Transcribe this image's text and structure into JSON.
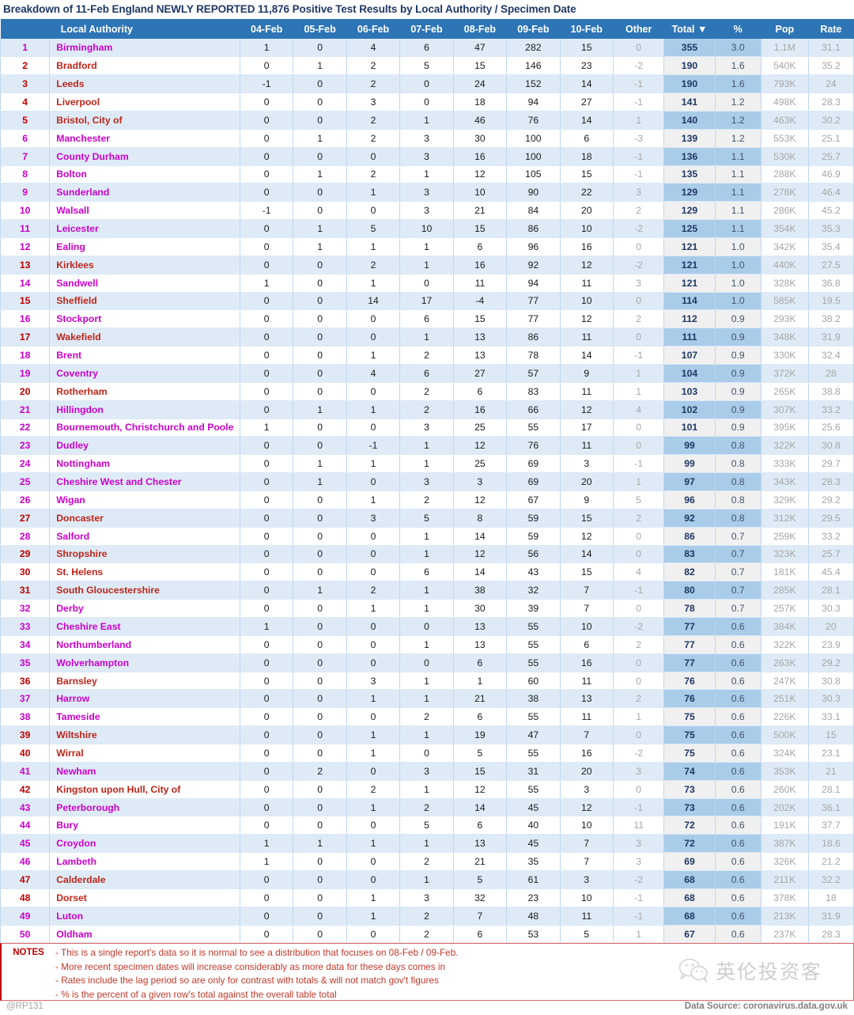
{
  "title": "Breakdown of 11-Feb England NEWLY REPORTED 11,876 Positive Test Results by Local Authority / Specimen Date",
  "colors": {
    "header_bg": "#2E75B6",
    "band_bg": "#DEEBF7",
    "total_band": "#A9CCE9",
    "magenta": "#CC00CC",
    "red": "#C0251A",
    "note_red": "#C0392B",
    "title_navy": "#1F3864"
  },
  "table": {
    "headers": [
      "",
      "Local Authority",
      "04-Feb",
      "05-Feb",
      "06-Feb",
      "07-Feb",
      "08-Feb",
      "09-Feb",
      "10-Feb",
      "Other",
      "Total ▼",
      "%",
      "Pop",
      "Rate"
    ],
    "sort_column": "Total",
    "sort_direction": "descending",
    "rows": [
      {
        "rank": "1",
        "la": "Birmingham",
        "color": "magenta",
        "d": [
          "1",
          "0",
          "4",
          "6",
          "47",
          "282",
          "15"
        ],
        "other": "0",
        "total": "355",
        "pct": "3.0",
        "pop": "1.1M",
        "rate": "31.1"
      },
      {
        "rank": "2",
        "la": "Bradford",
        "color": "red",
        "d": [
          "0",
          "1",
          "2",
          "5",
          "15",
          "146",
          "23"
        ],
        "other": "-2",
        "total": "190",
        "pct": "1.6",
        "pop": "540K",
        "rate": "35.2"
      },
      {
        "rank": "3",
        "la": "Leeds",
        "color": "red",
        "d": [
          "-1",
          "0",
          "2",
          "0",
          "24",
          "152",
          "14"
        ],
        "other": "-1",
        "total": "190",
        "pct": "1.6",
        "pop": "793K",
        "rate": "24"
      },
      {
        "rank": "4",
        "la": "Liverpool",
        "color": "red",
        "d": [
          "0",
          "0",
          "3",
          "0",
          "18",
          "94",
          "27"
        ],
        "other": "-1",
        "total": "141",
        "pct": "1.2",
        "pop": "498K",
        "rate": "28.3"
      },
      {
        "rank": "5",
        "la": "Bristol, City of",
        "color": "red",
        "d": [
          "0",
          "0",
          "2",
          "1",
          "46",
          "76",
          "14"
        ],
        "other": "1",
        "total": "140",
        "pct": "1.2",
        "pop": "463K",
        "rate": "30.2"
      },
      {
        "rank": "6",
        "la": "Manchester",
        "color": "magenta",
        "d": [
          "0",
          "1",
          "2",
          "3",
          "30",
          "100",
          "6"
        ],
        "other": "-3",
        "total": "139",
        "pct": "1.2",
        "pop": "553K",
        "rate": "25.1"
      },
      {
        "rank": "7",
        "la": "County Durham",
        "color": "magenta",
        "d": [
          "0",
          "0",
          "0",
          "3",
          "16",
          "100",
          "18"
        ],
        "other": "-1",
        "total": "136",
        "pct": "1.1",
        "pop": "530K",
        "rate": "25.7"
      },
      {
        "rank": "8",
        "la": "Bolton",
        "color": "magenta",
        "d": [
          "0",
          "1",
          "2",
          "1",
          "12",
          "105",
          "15"
        ],
        "other": "-1",
        "total": "135",
        "pct": "1.1",
        "pop": "288K",
        "rate": "46.9"
      },
      {
        "rank": "9",
        "la": "Sunderland",
        "color": "magenta",
        "d": [
          "0",
          "0",
          "1",
          "3",
          "10",
          "90",
          "22"
        ],
        "other": "3",
        "total": "129",
        "pct": "1.1",
        "pop": "278K",
        "rate": "46.4"
      },
      {
        "rank": "10",
        "la": "Walsall",
        "color": "magenta",
        "d": [
          "-1",
          "0",
          "0",
          "3",
          "21",
          "84",
          "20"
        ],
        "other": "2",
        "total": "129",
        "pct": "1.1",
        "pop": "286K",
        "rate": "45.2"
      },
      {
        "rank": "11",
        "la": "Leicester",
        "color": "magenta",
        "d": [
          "0",
          "1",
          "5",
          "10",
          "15",
          "86",
          "10"
        ],
        "other": "-2",
        "total": "125",
        "pct": "1.1",
        "pop": "354K",
        "rate": "35.3"
      },
      {
        "rank": "12",
        "la": "Ealing",
        "color": "magenta",
        "d": [
          "0",
          "1",
          "1",
          "1",
          "6",
          "96",
          "16"
        ],
        "other": "0",
        "total": "121",
        "pct": "1.0",
        "pop": "342K",
        "rate": "35.4"
      },
      {
        "rank": "13",
        "la": "Kirklees",
        "color": "red",
        "d": [
          "0",
          "0",
          "2",
          "1",
          "16",
          "92",
          "12"
        ],
        "other": "-2",
        "total": "121",
        "pct": "1.0",
        "pop": "440K",
        "rate": "27.5"
      },
      {
        "rank": "14",
        "la": "Sandwell",
        "color": "magenta",
        "d": [
          "1",
          "0",
          "1",
          "0",
          "11",
          "94",
          "11"
        ],
        "other": "3",
        "total": "121",
        "pct": "1.0",
        "pop": "328K",
        "rate": "36.8"
      },
      {
        "rank": "15",
        "la": "Sheffield",
        "color": "red",
        "d": [
          "0",
          "0",
          "14",
          "17",
          "-4",
          "77",
          "10"
        ],
        "other": "0",
        "total": "114",
        "pct": "1.0",
        "pop": "585K",
        "rate": "19.5"
      },
      {
        "rank": "16",
        "la": "Stockport",
        "color": "magenta",
        "d": [
          "0",
          "0",
          "0",
          "6",
          "15",
          "77",
          "12"
        ],
        "other": "2",
        "total": "112",
        "pct": "0.9",
        "pop": "293K",
        "rate": "38.2"
      },
      {
        "rank": "17",
        "la": "Wakefield",
        "color": "red",
        "d": [
          "0",
          "0",
          "0",
          "1",
          "13",
          "86",
          "11"
        ],
        "other": "0",
        "total": "111",
        "pct": "0.9",
        "pop": "348K",
        "rate": "31.9"
      },
      {
        "rank": "18",
        "la": "Brent",
        "color": "magenta",
        "d": [
          "0",
          "0",
          "1",
          "2",
          "13",
          "78",
          "14"
        ],
        "other": "-1",
        "total": "107",
        "pct": "0.9",
        "pop": "330K",
        "rate": "32.4"
      },
      {
        "rank": "19",
        "la": "Coventry",
        "color": "magenta",
        "d": [
          "0",
          "0",
          "4",
          "6",
          "27",
          "57",
          "9"
        ],
        "other": "1",
        "total": "104",
        "pct": "0.9",
        "pop": "372K",
        "rate": "28"
      },
      {
        "rank": "20",
        "la": "Rotherham",
        "color": "red",
        "d": [
          "0",
          "0",
          "0",
          "2",
          "6",
          "83",
          "11"
        ],
        "other": "1",
        "total": "103",
        "pct": "0.9",
        "pop": "265K",
        "rate": "38.8"
      },
      {
        "rank": "21",
        "la": "Hillingdon",
        "color": "magenta",
        "d": [
          "0",
          "1",
          "1",
          "2",
          "16",
          "66",
          "12"
        ],
        "other": "4",
        "total": "102",
        "pct": "0.9",
        "pop": "307K",
        "rate": "33.2"
      },
      {
        "rank": "22",
        "la": "Bournemouth, Christchurch and Poole",
        "color": "magenta",
        "d": [
          "1",
          "0",
          "0",
          "3",
          "25",
          "55",
          "17"
        ],
        "other": "0",
        "total": "101",
        "pct": "0.9",
        "pop": "395K",
        "rate": "25.6"
      },
      {
        "rank": "23",
        "la": "Dudley",
        "color": "magenta",
        "d": [
          "0",
          "0",
          "-1",
          "1",
          "12",
          "76",
          "11"
        ],
        "other": "0",
        "total": "99",
        "pct": "0.8",
        "pop": "322K",
        "rate": "30.8"
      },
      {
        "rank": "24",
        "la": "Nottingham",
        "color": "magenta",
        "d": [
          "0",
          "1",
          "1",
          "1",
          "25",
          "69",
          "3"
        ],
        "other": "-1",
        "total": "99",
        "pct": "0.8",
        "pop": "333K",
        "rate": "29.7"
      },
      {
        "rank": "25",
        "la": "Cheshire West and Chester",
        "color": "magenta",
        "d": [
          "0",
          "1",
          "0",
          "3",
          "3",
          "69",
          "20"
        ],
        "other": "1",
        "total": "97",
        "pct": "0.8",
        "pop": "343K",
        "rate": "28.3"
      },
      {
        "rank": "26",
        "la": "Wigan",
        "color": "magenta",
        "d": [
          "0",
          "0",
          "1",
          "2",
          "12",
          "67",
          "9"
        ],
        "other": "5",
        "total": "96",
        "pct": "0.8",
        "pop": "329K",
        "rate": "29.2"
      },
      {
        "rank": "27",
        "la": "Doncaster",
        "color": "red",
        "d": [
          "0",
          "0",
          "3",
          "5",
          "8",
          "59",
          "15"
        ],
        "other": "2",
        "total": "92",
        "pct": "0.8",
        "pop": "312K",
        "rate": "29.5"
      },
      {
        "rank": "28",
        "la": "Salford",
        "color": "magenta",
        "d": [
          "0",
          "0",
          "0",
          "1",
          "14",
          "59",
          "12"
        ],
        "other": "0",
        "total": "86",
        "pct": "0.7",
        "pop": "259K",
        "rate": "33.2"
      },
      {
        "rank": "29",
        "la": "Shropshire",
        "color": "red",
        "d": [
          "0",
          "0",
          "0",
          "1",
          "12",
          "56",
          "14"
        ],
        "other": "0",
        "total": "83",
        "pct": "0.7",
        "pop": "323K",
        "rate": "25.7"
      },
      {
        "rank": "30",
        "la": "St. Helens",
        "color": "red",
        "d": [
          "0",
          "0",
          "0",
          "6",
          "14",
          "43",
          "15"
        ],
        "other": "4",
        "total": "82",
        "pct": "0.7",
        "pop": "181K",
        "rate": "45.4"
      },
      {
        "rank": "31",
        "la": "South Gloucestershire",
        "color": "red",
        "d": [
          "0",
          "1",
          "2",
          "1",
          "38",
          "32",
          "7"
        ],
        "other": "-1",
        "total": "80",
        "pct": "0.7",
        "pop": "285K",
        "rate": "28.1"
      },
      {
        "rank": "32",
        "la": "Derby",
        "color": "magenta",
        "d": [
          "0",
          "0",
          "1",
          "1",
          "30",
          "39",
          "7"
        ],
        "other": "0",
        "total": "78",
        "pct": "0.7",
        "pop": "257K",
        "rate": "30.3"
      },
      {
        "rank": "33",
        "la": "Cheshire East",
        "color": "magenta",
        "d": [
          "1",
          "0",
          "0",
          "0",
          "13",
          "55",
          "10"
        ],
        "other": "-2",
        "total": "77",
        "pct": "0.6",
        "pop": "384K",
        "rate": "20"
      },
      {
        "rank": "34",
        "la": "Northumberland",
        "color": "magenta",
        "d": [
          "0",
          "0",
          "0",
          "1",
          "13",
          "55",
          "6"
        ],
        "other": "2",
        "total": "77",
        "pct": "0.6",
        "pop": "322K",
        "rate": "23.9"
      },
      {
        "rank": "35",
        "la": "Wolverhampton",
        "color": "magenta",
        "d": [
          "0",
          "0",
          "0",
          "0",
          "6",
          "55",
          "16"
        ],
        "other": "0",
        "total": "77",
        "pct": "0.6",
        "pop": "263K",
        "rate": "29.2"
      },
      {
        "rank": "36",
        "la": "Barnsley",
        "color": "red",
        "d": [
          "0",
          "0",
          "3",
          "1",
          "1",
          "60",
          "11"
        ],
        "other": "0",
        "total": "76",
        "pct": "0.6",
        "pop": "247K",
        "rate": "30.8"
      },
      {
        "rank": "37",
        "la": "Harrow",
        "color": "magenta",
        "d": [
          "0",
          "0",
          "1",
          "1",
          "21",
          "38",
          "13"
        ],
        "other": "2",
        "total": "76",
        "pct": "0.6",
        "pop": "251K",
        "rate": "30.3"
      },
      {
        "rank": "38",
        "la": "Tameside",
        "color": "magenta",
        "d": [
          "0",
          "0",
          "0",
          "2",
          "6",
          "55",
          "11"
        ],
        "other": "1",
        "total": "75",
        "pct": "0.6",
        "pop": "226K",
        "rate": "33.1"
      },
      {
        "rank": "39",
        "la": "Wiltshire",
        "color": "red",
        "d": [
          "0",
          "0",
          "1",
          "1",
          "19",
          "47",
          "7"
        ],
        "other": "0",
        "total": "75",
        "pct": "0.6",
        "pop": "500K",
        "rate": "15"
      },
      {
        "rank": "40",
        "la": "Wirral",
        "color": "red",
        "d": [
          "0",
          "0",
          "1",
          "0",
          "5",
          "55",
          "16"
        ],
        "other": "-2",
        "total": "75",
        "pct": "0.6",
        "pop": "324K",
        "rate": "23.1"
      },
      {
        "rank": "41",
        "la": "Newham",
        "color": "magenta",
        "d": [
          "0",
          "2",
          "0",
          "3",
          "15",
          "31",
          "20"
        ],
        "other": "3",
        "total": "74",
        "pct": "0.6",
        "pop": "353K",
        "rate": "21"
      },
      {
        "rank": "42",
        "la": "Kingston upon Hull, City of",
        "color": "red",
        "d": [
          "0",
          "0",
          "2",
          "1",
          "12",
          "55",
          "3"
        ],
        "other": "0",
        "total": "73",
        "pct": "0.6",
        "pop": "260K",
        "rate": "28.1"
      },
      {
        "rank": "43",
        "la": "Peterborough",
        "color": "magenta",
        "d": [
          "0",
          "0",
          "1",
          "2",
          "14",
          "45",
          "12"
        ],
        "other": "-1",
        "total": "73",
        "pct": "0.6",
        "pop": "202K",
        "rate": "36.1"
      },
      {
        "rank": "44",
        "la": "Bury",
        "color": "magenta",
        "d": [
          "0",
          "0",
          "0",
          "5",
          "6",
          "40",
          "10"
        ],
        "other": "11",
        "total": "72",
        "pct": "0.6",
        "pop": "191K",
        "rate": "37.7"
      },
      {
        "rank": "45",
        "la": "Croydon",
        "color": "magenta",
        "d": [
          "1",
          "1",
          "1",
          "1",
          "13",
          "45",
          "7"
        ],
        "other": "3",
        "total": "72",
        "pct": "0.6",
        "pop": "387K",
        "rate": "18.6"
      },
      {
        "rank": "46",
        "la": "Lambeth",
        "color": "magenta",
        "d": [
          "1",
          "0",
          "0",
          "2",
          "21",
          "35",
          "7"
        ],
        "other": "3",
        "total": "69",
        "pct": "0.6",
        "pop": "326K",
        "rate": "21.2"
      },
      {
        "rank": "47",
        "la": "Calderdale",
        "color": "red",
        "d": [
          "0",
          "0",
          "0",
          "1",
          "5",
          "61",
          "3"
        ],
        "other": "-2",
        "total": "68",
        "pct": "0.6",
        "pop": "211K",
        "rate": "32.2"
      },
      {
        "rank": "48",
        "la": "Dorset",
        "color": "red",
        "d": [
          "0",
          "0",
          "1",
          "3",
          "32",
          "23",
          "10"
        ],
        "other": "-1",
        "total": "68",
        "pct": "0.6",
        "pop": "378K",
        "rate": "18"
      },
      {
        "rank": "49",
        "la": "Luton",
        "color": "magenta",
        "d": [
          "0",
          "0",
          "1",
          "2",
          "7",
          "48",
          "11"
        ],
        "other": "-1",
        "total": "68",
        "pct": "0.6",
        "pop": "213K",
        "rate": "31.9"
      },
      {
        "rank": "50",
        "la": "Oldham",
        "color": "magenta",
        "d": [
          "0",
          "0",
          "0",
          "2",
          "6",
          "53",
          "5"
        ],
        "other": "1",
        "total": "67",
        "pct": "0.6",
        "pop": "237K",
        "rate": "28.3"
      }
    ]
  },
  "notes": {
    "label": "NOTES",
    "lines": [
      "- This is a single report's data so it is normal to see a distribution that focuses on 08-Feb / 09-Feb.",
      "- More recent specimen dates will increase considerably as more data for these days comes in",
      "- Rates include the lag period so are only for contrast with totals & will not match gov't figures",
      "- % is the percent of a given row's total against the overall table total"
    ]
  },
  "watermark": {
    "text": "英伦投资客",
    "icon": "wechat-icon"
  },
  "footer": {
    "handle": "@RP131",
    "source": "Data Source: coronavirus.data.gov.uk"
  }
}
